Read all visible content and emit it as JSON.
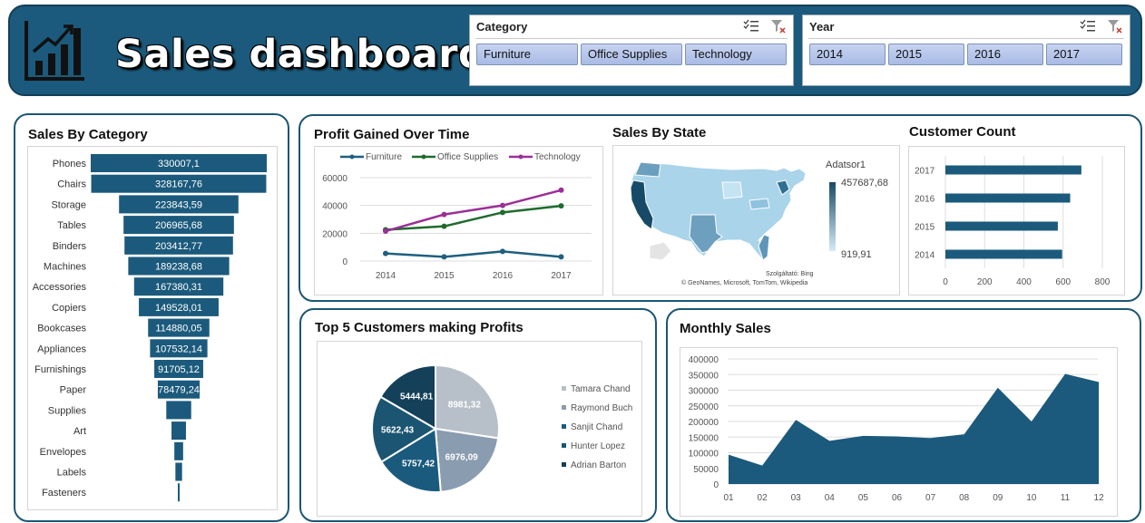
{
  "header": {
    "title": "Sales dashboard",
    "icon": "bar-chart-growth-icon"
  },
  "slicers": {
    "category": {
      "title": "Category",
      "items": [
        "Furniture",
        "Office Supplies",
        "Technology"
      ]
    },
    "year": {
      "title": "Year",
      "items": [
        "2014",
        "2015",
        "2016",
        "2017"
      ]
    }
  },
  "colors": {
    "primary": "#1b5a7c",
    "furniture": "#1f5f7f",
    "office": "#1e6b2e",
    "technology": "#9b2f96"
  },
  "panels": {
    "sales_by_category": "Sales By Category",
    "profit_over_time": "Profit Gained Over Time",
    "sales_by_state": "Sales By State",
    "customer_count": "Customer Count",
    "top5": "Top 5 Customers making Profits",
    "monthly_sales": "Monthly Sales"
  },
  "map": {
    "legend_title": "Adatsor1",
    "max_label": "457687,68",
    "min_label": "919,91",
    "attribution_top": "Szolgáltató: Bing",
    "attribution": "© GeoNames, Microsoft, TomTom, Wikipedia"
  },
  "chart_data": [
    {
      "id": "sales_by_category",
      "type": "bar",
      "orientation": "horizontal-funnel",
      "title": "Sales By Category",
      "categories": [
        "Phones",
        "Chairs",
        "Storage",
        "Tables",
        "Binders",
        "Machines",
        "Accessories",
        "Copiers",
        "Bookcases",
        "Appliances",
        "Furnishings",
        "Paper",
        "Supplies",
        "Art",
        "Envelopes",
        "Labels",
        "Fasteners"
      ],
      "values": [
        330007.1,
        328167.76,
        223843.59,
        206965.68,
        203412.77,
        189238.68,
        167380.31,
        149528.01,
        114880.05,
        107532.14,
        91705.12,
        78479.24,
        46673.54,
        27118.79,
        16476.4,
        12486.31,
        3024.28
      ],
      "labels": [
        "330007,1",
        "328167,76",
        "223843,59",
        "206965,68",
        "203412,77",
        "189238,68",
        "167380,31",
        "149528,01",
        "114880,05",
        "107532,14",
        "91705,12",
        "78479,24",
        "",
        "",
        "",
        "",
        ""
      ]
    },
    {
      "id": "profit_over_time",
      "type": "line",
      "title": "Profit Gained Over Time",
      "x": [
        "2014",
        "2015",
        "2016",
        "2017"
      ],
      "series": [
        {
          "name": "Furniture",
          "values": [
            5500,
            3000,
            6900,
            3000
          ]
        },
        {
          "name": "Office Supplies",
          "values": [
            22500,
            25000,
            35000,
            39700
          ]
        },
        {
          "name": "Technology",
          "values": [
            21500,
            33500,
            40000,
            51000
          ]
        }
      ],
      "ylim": [
        0,
        60000
      ],
      "yticks": [
        0,
        20000,
        40000,
        60000
      ],
      "legend": "top"
    },
    {
      "id": "customer_count",
      "type": "bar",
      "orientation": "horizontal",
      "title": "Customer Count",
      "categories": [
        "2017",
        "2016",
        "2015",
        "2014"
      ],
      "values": [
        693,
        636,
        573,
        595
      ],
      "xlim": [
        0,
        800
      ],
      "xticks": [
        0,
        200,
        400,
        600,
        800
      ]
    },
    {
      "id": "top5_customers",
      "type": "pie",
      "title": "Top 5 Customers making Profits",
      "labels": [
        "Tamara Chand",
        "Raymond Buch",
        "Sanjit Chand",
        "Hunter Lopez",
        "Adrian Barton"
      ],
      "values": [
        8981.32,
        6976.09,
        5757.42,
        5622.43,
        5444.81
      ],
      "value_labels": [
        "8981,32",
        "6976,09",
        "5757,42",
        "5622,43",
        "5444,81"
      ],
      "colors": [
        "#b7c0c9",
        "#8a9cb0",
        "#1a5a7d",
        "#1b5572",
        "#14405a"
      ],
      "legend": "right"
    },
    {
      "id": "monthly_sales",
      "type": "area",
      "title": "Monthly Sales",
      "x": [
        "01",
        "02",
        "03",
        "04",
        "05",
        "06",
        "07",
        "08",
        "09",
        "10",
        "11",
        "12"
      ],
      "values": [
        94000,
        59000,
        205000,
        138000,
        154000,
        152000,
        147000,
        159000,
        308000,
        200000,
        352000,
        326000
      ],
      "ylim": [
        0,
        400000
      ],
      "yticks": [
        0,
        50000,
        100000,
        150000,
        200000,
        250000,
        300000,
        350000,
        400000
      ]
    }
  ]
}
